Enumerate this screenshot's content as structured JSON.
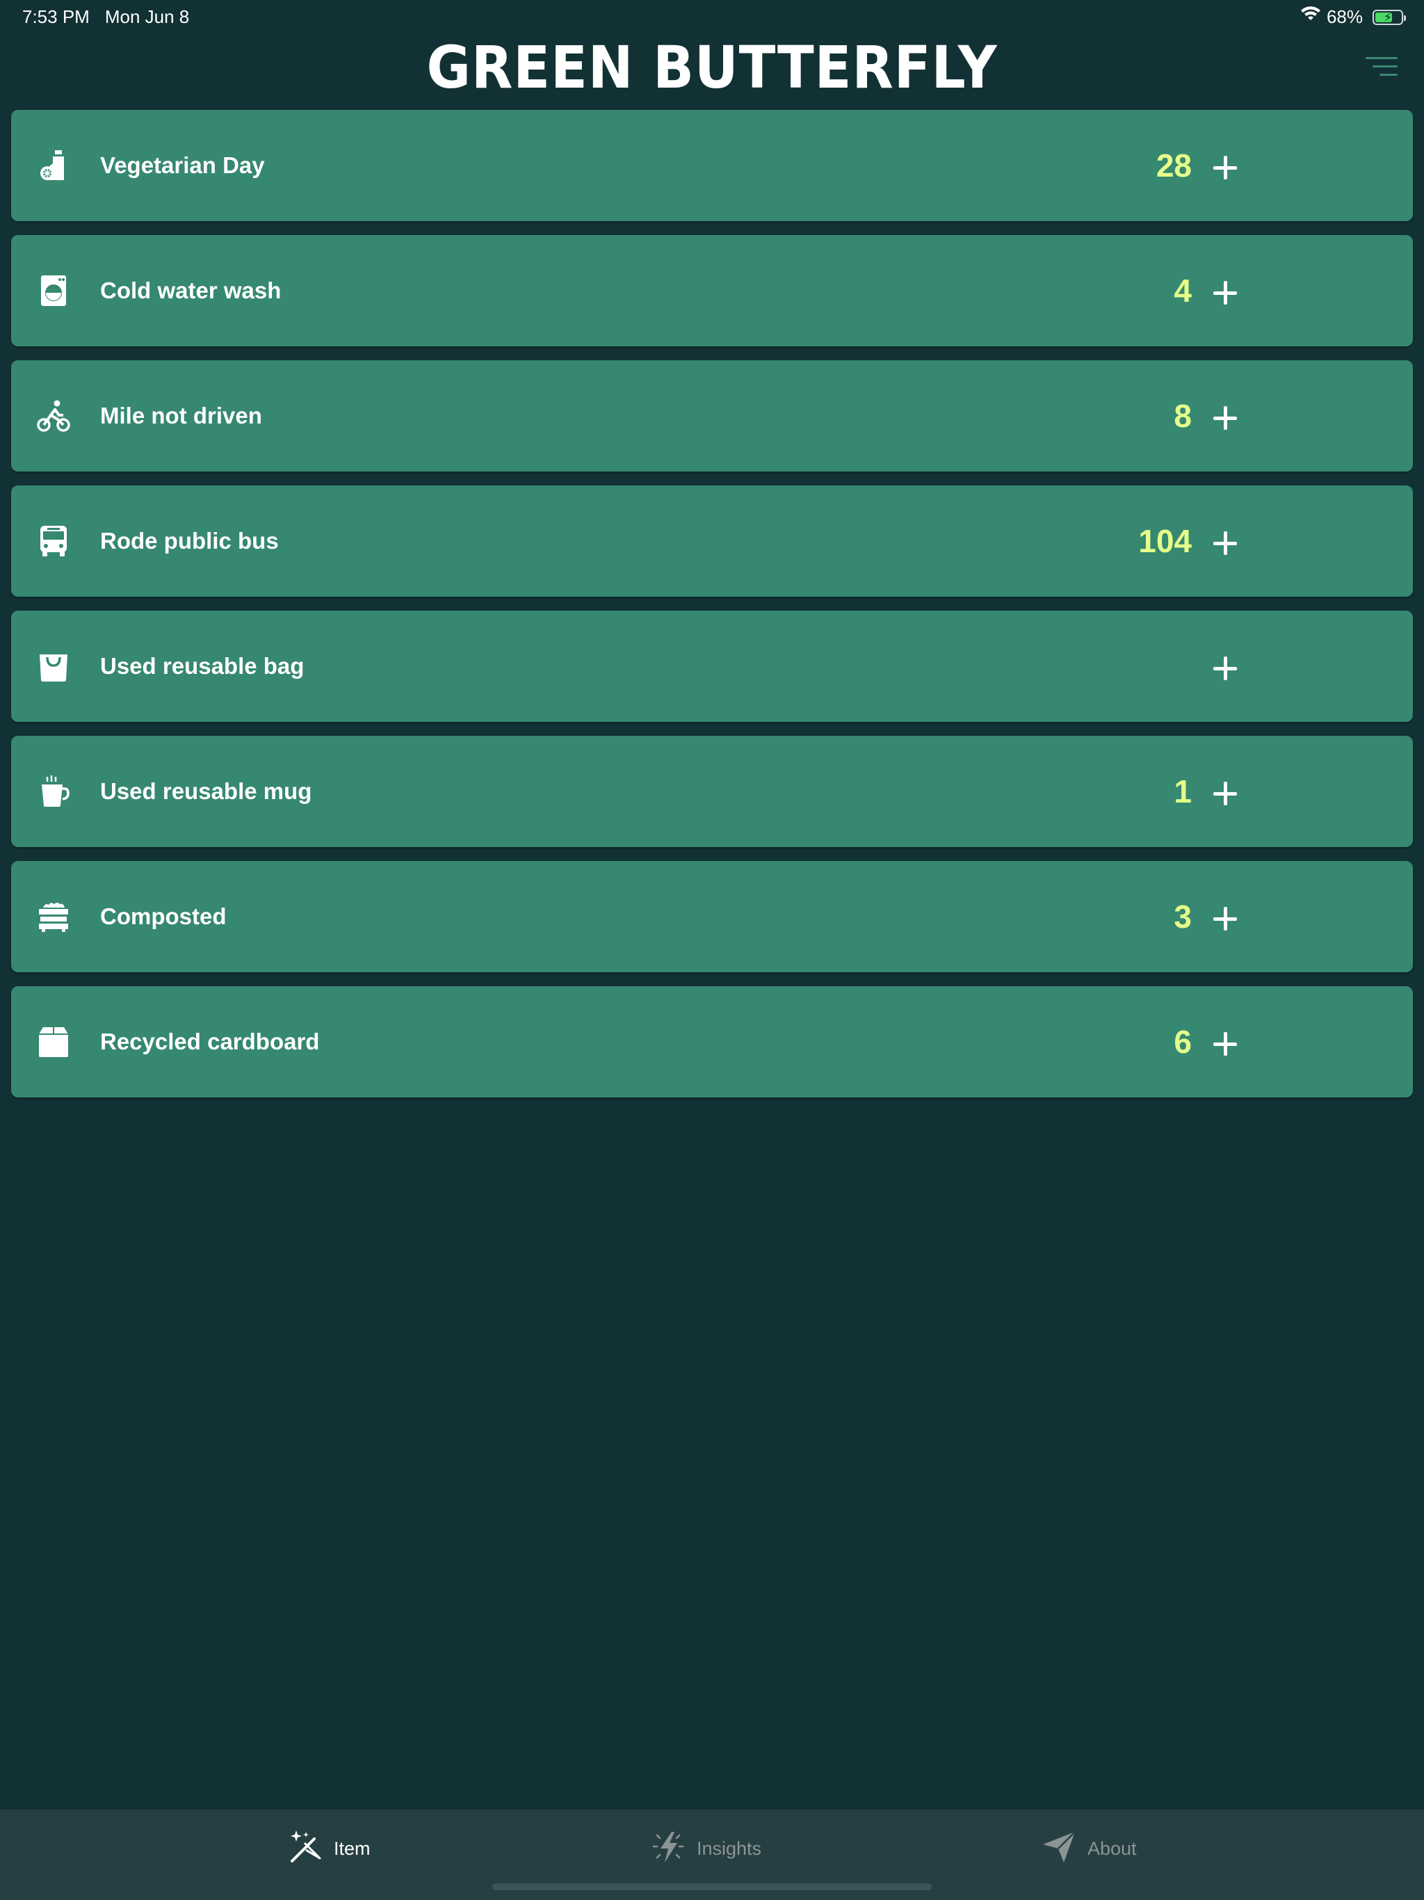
{
  "status_bar": {
    "time": "7:53 PM",
    "date": "Mon Jun 8",
    "battery_percent": "68%",
    "battery_level": 0.68,
    "wifi_icon": "wifi-icon",
    "charging": true
  },
  "header": {
    "title": "Green Butterfly",
    "menu_icon": "filter-menu-icon"
  },
  "colors": {
    "background": "#123135",
    "row": "#368870",
    "count": "#e6ff8a",
    "tab_bar": "#263f42"
  },
  "items": [
    {
      "label": "Vegetarian Day",
      "count": "28",
      "icon": "bottle-icon"
    },
    {
      "label": "Cold water wash",
      "count": "4",
      "icon": "washing-machine-icon"
    },
    {
      "label": "Mile not driven",
      "count": "8",
      "icon": "bicycle-icon"
    },
    {
      "label": "Rode public bus",
      "count": "104",
      "icon": "bus-icon"
    },
    {
      "label": "Used reusable bag",
      "count": "",
      "icon": "shopping-bag-icon"
    },
    {
      "label": "Used reusable mug",
      "count": "1",
      "icon": "mug-icon"
    },
    {
      "label": "Composted",
      "count": "3",
      "icon": "compost-bin-icon"
    },
    {
      "label": "Recycled cardboard",
      "count": "6",
      "icon": "box-icon"
    }
  ],
  "tabs": [
    {
      "label": "Item",
      "icon": "magic-wand-icon",
      "active": true
    },
    {
      "label": "Insights",
      "icon": "lightning-icon",
      "active": false
    },
    {
      "label": "About",
      "icon": "paper-plane-icon",
      "active": false
    }
  ]
}
